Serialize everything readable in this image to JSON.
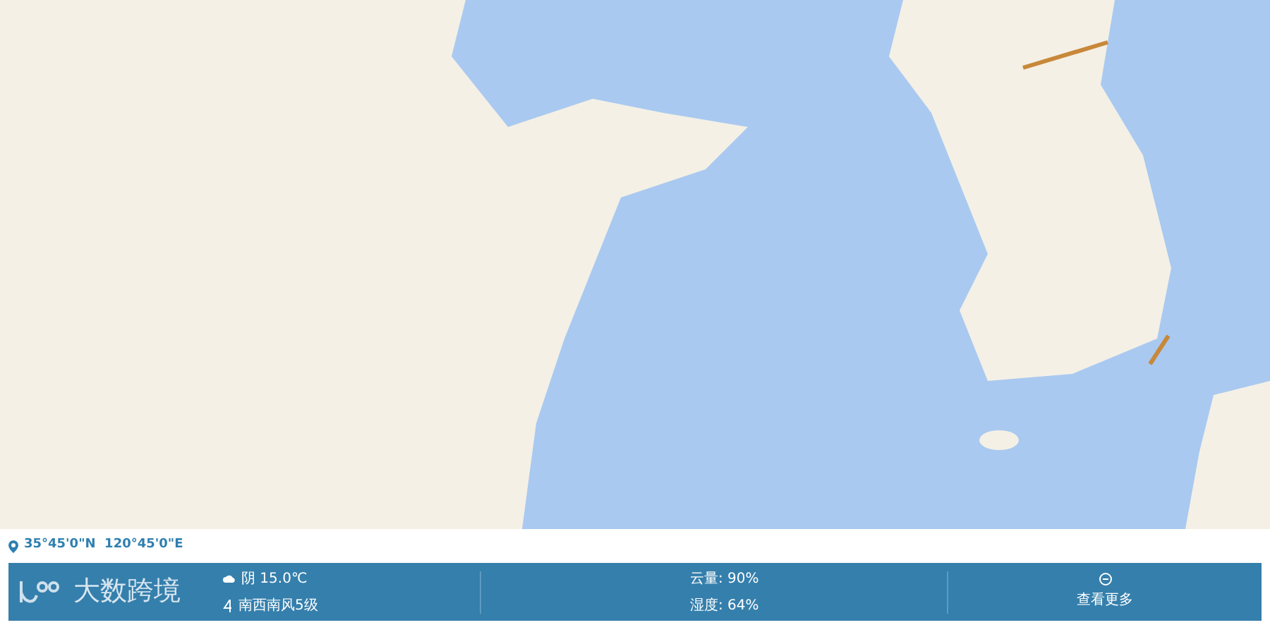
{
  "coordinates": "35°45'0\"N  120°45'0\"E",
  "weather_bar": {
    "brand": "大数跨境",
    "condition": "阴 15.0℃",
    "wind": "南西南风5级",
    "cloud_cover": "云量: 90%",
    "humidity": "湿度: 64%",
    "more_link": "查看更多"
  }
}
